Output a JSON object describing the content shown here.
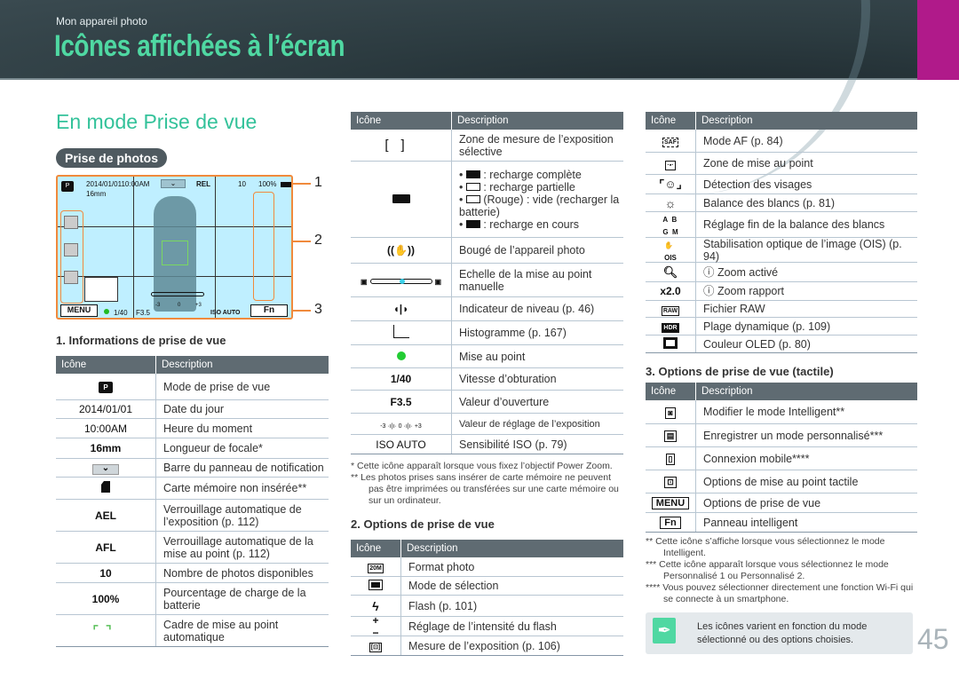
{
  "header": {
    "section": "Mon appareil photo",
    "title": "Icônes affichées à l’écran",
    "accent": "#b01a8a",
    "title_color": "#4fd8a2"
  },
  "heading": "En mode Prise de vue",
  "pill": "Prise de photos",
  "camera_screen": {
    "datetime": "2014/01/0110:00AM",
    "focal": "16mm",
    "ael": "REL",
    "shots": "10",
    "battery": "100%",
    "menu": "MENU",
    "fn": "Fn",
    "shutter": "1/40",
    "aperture": "F3.5",
    "ev_min": "-3",
    "ev_zero": "0",
    "ev_max": "+3",
    "iso": "ISO AUTO",
    "callouts": [
      "1",
      "2",
      "3"
    ]
  },
  "section1": {
    "title": "1. Informations de prise de vue",
    "col_icon": "Icône",
    "col_desc": "Description",
    "rows": [
      {
        "icon": "camera-mode-p-icon",
        "desc": "Mode de prise de vue"
      },
      {
        "icon_text": "2014/01/01",
        "desc": "Date du jour"
      },
      {
        "icon_text": "10:00AM",
        "desc": "Heure du moment"
      },
      {
        "icon_text": "16mm",
        "desc": "Longueur de focale*"
      },
      {
        "icon": "chevron-down-icon",
        "desc": "Barre du panneau de notification"
      },
      {
        "icon": "no-memory-card-icon",
        "desc": "Carte mémoire non insérée**"
      },
      {
        "icon_text": "AEL",
        "desc": "Verrouillage automatique de l’exposition (p. 112)"
      },
      {
        "icon_text": "AFL",
        "desc": "Verrouillage automatique de la mise au point (p. 112)"
      },
      {
        "icon_text": "10",
        "desc": "Nombre de photos disponibles"
      },
      {
        "icon_text": "100%",
        "desc": "Pourcentage de charge de la batterie"
      },
      {
        "icon": "af-frame-icon",
        "desc": "Cadre de mise au point automatique"
      }
    ]
  },
  "middle_table": {
    "col_icon": "Icône",
    "col_desc": "Description",
    "rows": [
      {
        "icon": "spot-metering-bracket-icon",
        "desc": "Zone de mesure de l’exposition sélective"
      },
      {
        "icon": "battery-icon",
        "bullets": [
          ": recharge complète",
          ": recharge partielle",
          "(Rouge) : vide (recharger la batterie)",
          ": recharge en cours"
        ]
      },
      {
        "icon": "hand-shake-icon",
        "desc": "Bougé de l’appareil photo"
      },
      {
        "icon": "manual-focus-scale-icon",
        "desc": "Echelle de la mise au point manuelle"
      },
      {
        "icon": "level-indicator-icon",
        "desc": "Indicateur de niveau (p. 46)"
      },
      {
        "icon": "histogram-icon",
        "desc": "Histogramme (p. 167)"
      },
      {
        "icon": "focus-dot-icon",
        "desc": "Mise au point"
      },
      {
        "icon_text": "1/40",
        "desc": "Vitesse d’obturation"
      },
      {
        "icon_text": "F3.5",
        "desc": "Valeur d’ouverture"
      },
      {
        "icon": "exposure-scale-icon",
        "desc": "Valeur de réglage de l’exposition"
      },
      {
        "icon_text": "ISO AUTO",
        "desc": "Sensibilité ISO (p. 79)"
      }
    ]
  },
  "middle_footnotes": [
    "* Cette icône apparaît lorsque vous fixez l’objectif Power Zoom.",
    "** Les photos prises sans insérer de carte mémoire ne peuvent pas être imprimées ou transférées sur une carte mémoire ou sur un ordinateur."
  ],
  "section2": {
    "title": "2. Options de prise de vue",
    "col_icon": "Icône",
    "col_desc": "Description",
    "rows": [
      {
        "icon": "photo-size-20m-icon",
        "desc": "Format photo"
      },
      {
        "icon": "drive-mode-single-icon",
        "desc": "Mode de sélection"
      },
      {
        "icon": "flash-icon",
        "desc": "Flash (p. 101)"
      },
      {
        "icon": "flash-intensity-icon",
        "desc": "Réglage de l’intensité du flash"
      },
      {
        "icon": "metering-icon",
        "desc": "Mesure de l’exposition (p. 106)"
      }
    ]
  },
  "right_table": {
    "col_icon": "Icône",
    "col_desc": "Description",
    "rows": [
      {
        "icon": "saf-icon",
        "desc": "Mode AF (p. 84)"
      },
      {
        "icon": "focus-area-icon",
        "desc": "Zone de mise au point"
      },
      {
        "icon": "face-detection-icon",
        "desc": "Détection des visages"
      },
      {
        "icon": "white-balance-icon",
        "desc": "Balance des blancs (p. 81)"
      },
      {
        "icon": "wb-fine-tune-icon",
        "desc": "Réglage fin de la balance des blancs"
      },
      {
        "icon": "ois-icon",
        "desc": "Stabilisation optique de l’image (OIS) (p. 94)"
      },
      {
        "icon": "zoom-magnifier-icon",
        "desc": "ⓘ Zoom activé"
      },
      {
        "icon_text": "x2.0",
        "desc": "ⓘ Zoom rapport"
      },
      {
        "icon": "raw-icon",
        "desc": "Fichier RAW"
      },
      {
        "icon": "hdr-icon",
        "desc": "Plage dynamique (p. 109)"
      },
      {
        "icon": "oled-color-icon",
        "desc": "Couleur OLED (p. 80)"
      }
    ]
  },
  "section3": {
    "title": "3. Options de prise de vue (tactile)",
    "col_icon": "Icône",
    "col_desc": "Description",
    "rows": [
      {
        "icon": "smart-mode-icon",
        "desc": "Modifier le mode Intelligent**"
      },
      {
        "icon": "save-custom-mode-icon",
        "desc": "Enregistrer un mode personnalisé***"
      },
      {
        "icon": "mobile-link-icon",
        "desc": "Connexion mobile****"
      },
      {
        "icon": "touch-af-icon",
        "desc": "Options de mise au point tactile"
      },
      {
        "icon_text": "MENU",
        "desc": "Options de prise de vue"
      },
      {
        "icon_text": "Fn",
        "desc": "Panneau intelligent"
      }
    ]
  },
  "right_footnotes": [
    "** Cette icône s’affiche lorsque vous sélectionnez le mode Intelligent.",
    "*** Cette icône apparaît lorsque vous sélectionnez le mode Personnalisé 1 ou Personnalisé 2.",
    "**** Vous pouvez sélectionner directement une fonction Wi-Fi qui se connecte à un smartphone."
  ],
  "note": "Les icônes varient en fonction du mode sélectionné ou des options choisies.",
  "page_number": "45"
}
